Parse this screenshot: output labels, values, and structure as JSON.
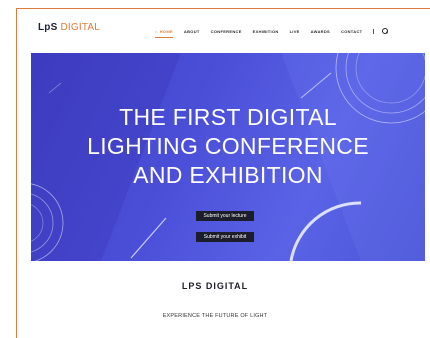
{
  "header": {
    "logo_bold": "LpS",
    "logo_light": "DIGITAL",
    "nav": [
      {
        "label": "HOME",
        "active": true
      },
      {
        "label": "ABOUT"
      },
      {
        "label": "CONFERENCE"
      },
      {
        "label": "EXHIBITION"
      },
      {
        "label": "LIVE"
      },
      {
        "label": "AWARDS"
      },
      {
        "label": "CONTACT"
      }
    ],
    "home_icon": "home-icon",
    "search_icon": "search-icon"
  },
  "hero": {
    "title_line1": "THE FIRST DIGITAL",
    "title_line2": "LIGHTING CONFERENCE",
    "title_line3": "AND EXHIBITION",
    "button_lecture": "Submit your lecture",
    "button_exhibit": "Submit your exhibit"
  },
  "section": {
    "title": "LPS DIGITAL",
    "subtitle": "EXPERIENCE THE FUTURE OF LIGHT"
  },
  "colors": {
    "accent": "#e07b39",
    "hero_blue": "#4b4fd8",
    "button_dark": "#1b1d2b"
  }
}
